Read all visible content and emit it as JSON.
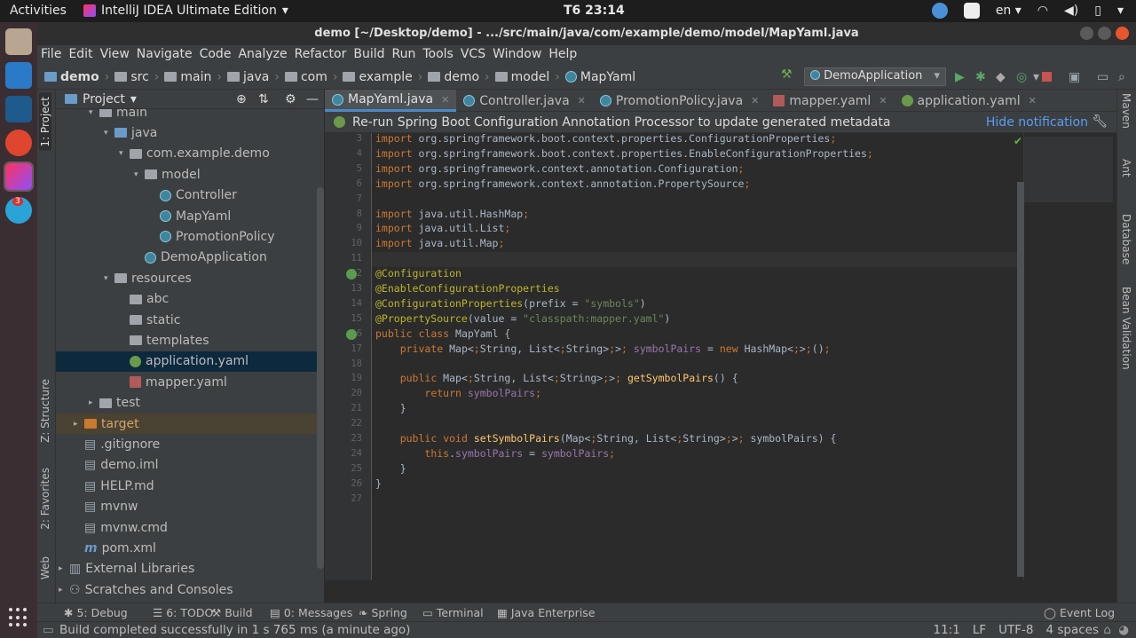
{
  "desktop": {
    "activities": "Activities",
    "app_name": "IntelliJ IDEA Ultimate Edition",
    "clock": "T6 23:14",
    "lang": "en",
    "dock_badge": "3"
  },
  "window": {
    "title": "demo [~/Desktop/demo] - .../src/main/java/com/example/demo/model/MapYaml.java"
  },
  "menu": [
    "File",
    "Edit",
    "View",
    "Navigate",
    "Code",
    "Analyze",
    "Refactor",
    "Build",
    "Run",
    "Tools",
    "VCS",
    "Window",
    "Help"
  ],
  "breadcrumb": [
    "demo",
    "src",
    "main",
    "java",
    "com",
    "example",
    "demo",
    "model",
    "MapYaml"
  ],
  "run_config": "DemoApplication",
  "left_tabs": {
    "project": "1: Project",
    "structure": "Z: Structure",
    "favorites": "2: Favorites",
    "web": "Web"
  },
  "project_panel": {
    "title": "Project"
  },
  "tree": [
    {
      "label": "main",
      "depth": 3,
      "arrow": "▾",
      "icon": "folder"
    },
    {
      "label": "java",
      "depth": 4,
      "arrow": "▾",
      "icon": "folder-blue"
    },
    {
      "label": "com.example.demo",
      "depth": 5,
      "arrow": "▾",
      "icon": "folder"
    },
    {
      "label": "model",
      "depth": 6,
      "arrow": "▾",
      "icon": "folder"
    },
    {
      "label": "Controller",
      "depth": 7,
      "arrow": "",
      "icon": "class"
    },
    {
      "label": "MapYaml",
      "depth": 7,
      "arrow": "",
      "icon": "class"
    },
    {
      "label": "PromotionPolicy",
      "depth": 7,
      "arrow": "",
      "icon": "class"
    },
    {
      "label": "DemoApplication",
      "depth": 6,
      "arrow": "",
      "icon": "class"
    },
    {
      "label": "resources",
      "depth": 4,
      "arrow": "▾",
      "icon": "folder"
    },
    {
      "label": "abc",
      "depth": 5,
      "arrow": "",
      "icon": "folder"
    },
    {
      "label": "static",
      "depth": 5,
      "arrow": "",
      "icon": "folder"
    },
    {
      "label": "templates",
      "depth": 5,
      "arrow": "",
      "icon": "folder"
    },
    {
      "label": "application.yaml",
      "depth": 5,
      "arrow": "",
      "icon": "yaml-spring",
      "selected": true
    },
    {
      "label": "mapper.yaml",
      "depth": 5,
      "arrow": "",
      "icon": "yaml"
    },
    {
      "label": "test",
      "depth": 3,
      "arrow": "▸",
      "icon": "folder"
    },
    {
      "label": "target",
      "depth": 2,
      "arrow": "▸",
      "icon": "folder-orange",
      "target": true
    },
    {
      "label": ".gitignore",
      "depth": 2,
      "arrow": "",
      "icon": "file"
    },
    {
      "label": "demo.iml",
      "depth": 2,
      "arrow": "",
      "icon": "file"
    },
    {
      "label": "HELP.md",
      "depth": 2,
      "arrow": "",
      "icon": "file"
    },
    {
      "label": "mvnw",
      "depth": 2,
      "arrow": "",
      "icon": "file"
    },
    {
      "label": "mvnw.cmd",
      "depth": 2,
      "arrow": "",
      "icon": "file"
    },
    {
      "label": "pom.xml",
      "depth": 2,
      "arrow": "",
      "icon": "maven"
    },
    {
      "label": "External Libraries",
      "depth": 1,
      "arrow": "▸",
      "icon": "lib"
    },
    {
      "label": "Scratches and Consoles",
      "depth": 1,
      "arrow": "▸",
      "icon": "scratch"
    }
  ],
  "tabs": [
    {
      "label": "MapYaml.java",
      "icon": "class",
      "active": true
    },
    {
      "label": "Controller.java",
      "icon": "class"
    },
    {
      "label": "PromotionPolicy.java",
      "icon": "class"
    },
    {
      "label": "mapper.yaml",
      "icon": "yaml"
    },
    {
      "label": "application.yaml",
      "icon": "yaml-spring"
    }
  ],
  "notification": {
    "text": "Re-run Spring Boot Configuration Annotation Processor to update generated metadata",
    "action": "Hide notification"
  },
  "code": [
    {
      "n": "3",
      "t": "import org.springframework.boot.context.properties.ConfigurationProperties;"
    },
    {
      "n": "4",
      "t": "import org.springframework.boot.context.properties.EnableConfigurationProperties;"
    },
    {
      "n": "5",
      "t": "import org.springframework.context.annotation.Configuration;"
    },
    {
      "n": "6",
      "t": "import org.springframework.context.annotation.PropertySource;"
    },
    {
      "n": "7",
      "t": ""
    },
    {
      "n": "8",
      "t": "import java.util.HashMap;"
    },
    {
      "n": "9",
      "t": "import java.util.List;"
    },
    {
      "n": "10",
      "t": "import java.util.Map;"
    },
    {
      "n": "11",
      "t": ""
    },
    {
      "n": "12",
      "t": "@Configuration"
    },
    {
      "n": "13",
      "t": "@EnableConfigurationProperties"
    },
    {
      "n": "14",
      "t": "@ConfigurationProperties(prefix = \"symbols\")"
    },
    {
      "n": "15",
      "t": "@PropertySource(value = \"classpath:mapper.yaml\")"
    },
    {
      "n": "16",
      "t": "public class MapYaml {"
    },
    {
      "n": "17",
      "t": "    private Map<String, List<String>> symbolPairs = new HashMap<>();"
    },
    {
      "n": "18",
      "t": ""
    },
    {
      "n": "19",
      "t": "    public Map<String, List<String>> getSymbolPairs() {"
    },
    {
      "n": "20",
      "t": "        return symbolPairs;"
    },
    {
      "n": "21",
      "t": "    }"
    },
    {
      "n": "22",
      "t": ""
    },
    {
      "n": "23",
      "t": "    public void setSymbolPairs(Map<String, List<String>> symbolPairs) {"
    },
    {
      "n": "24",
      "t": "        this.symbolPairs = symbolPairs;"
    },
    {
      "n": "25",
      "t": "    }"
    },
    {
      "n": "26",
      "t": "}"
    },
    {
      "n": "27",
      "t": ""
    }
  ],
  "right_tabs": [
    "Maven",
    "Ant",
    "Database",
    "Bean Validation"
  ],
  "bottom_tools": [
    {
      "label": "5: Debug",
      "icon": "bug-icon"
    },
    {
      "label": "6: TODO",
      "icon": "todo-icon"
    },
    {
      "label": "Build",
      "icon": "hammer-icon"
    },
    {
      "label": "0: Messages",
      "icon": "messages-icon"
    },
    {
      "label": "Spring",
      "icon": "spring-icon"
    },
    {
      "label": "Terminal",
      "icon": "terminal-icon"
    },
    {
      "label": "Java Enterprise",
      "icon": "java-enterprise-icon"
    }
  ],
  "event_log": "Event Log",
  "status": {
    "message": "Build completed successfully in 1 s 765 ms (a minute ago)",
    "position": "11:1",
    "line_sep": "LF",
    "encoding": "UTF-8",
    "indent": "4 spaces"
  }
}
